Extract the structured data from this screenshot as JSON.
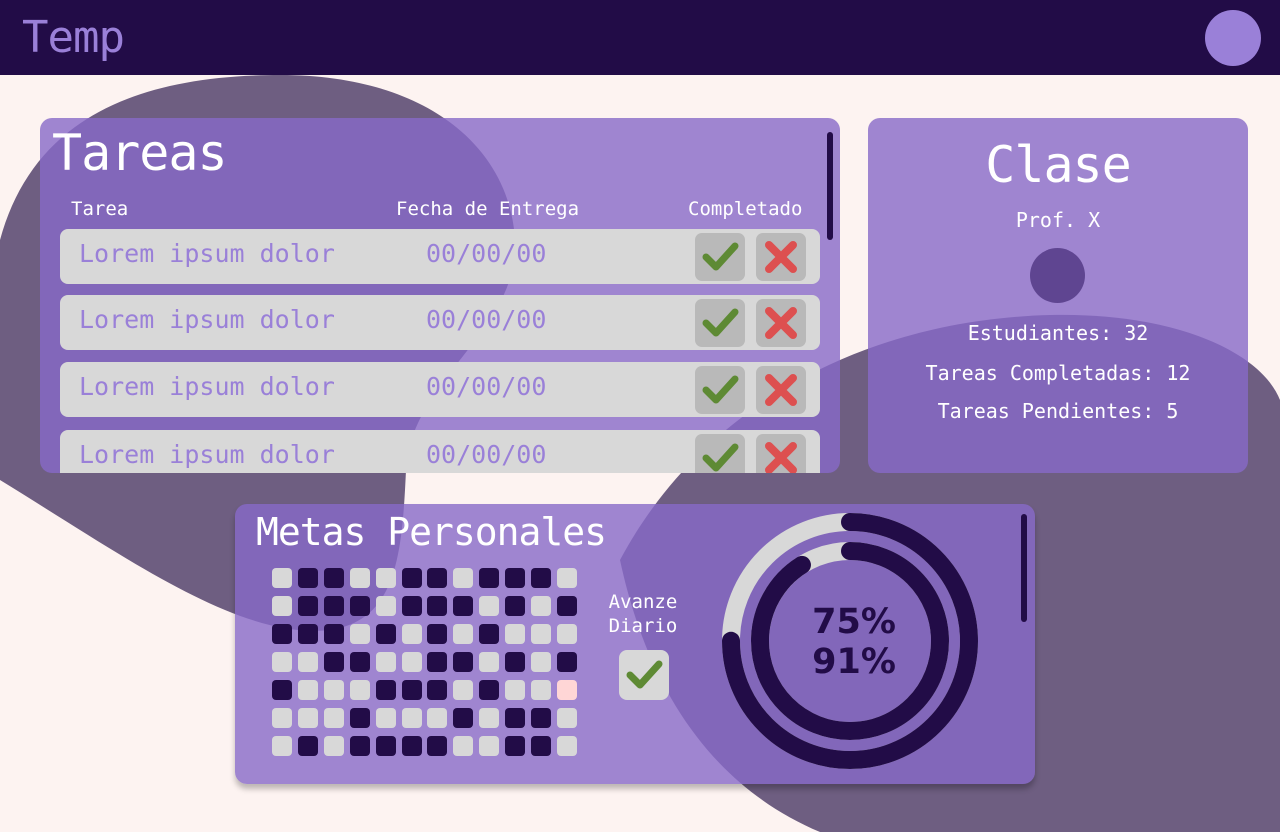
{
  "app": {
    "title": "Temp"
  },
  "colors": {
    "background": "#fdf3f1",
    "header": "#220c47",
    "accent": "#9a80d8",
    "panel": "#8769c8",
    "blob": "#6e5e81",
    "row": "#d8d8d8",
    "check": "#5e8a34",
    "cross": "#dd5050",
    "cell_on": "#220c47",
    "cell_off": "#d8d8d8",
    "cell_today": "#ffd6d6"
  },
  "tasks": {
    "title": "Tareas",
    "headers": {
      "task": "Tarea",
      "due": "Fecha de Entrega",
      "done": "Completado"
    },
    "rows": [
      {
        "name": "Lorem ipsum dolor",
        "due": "00/00/00"
      },
      {
        "name": "Lorem ipsum dolor",
        "due": "00/00/00"
      },
      {
        "name": "Lorem ipsum dolor",
        "due": "00/00/00"
      },
      {
        "name": "Lorem ipsum dolor",
        "due": "00/00/00"
      }
    ]
  },
  "class_info": {
    "title": "Clase",
    "professor": "Prof. X",
    "students": "Estudiantes: 32",
    "completed": "Tareas Completadas: 12",
    "pending": "Tareas Pendientes: 5"
  },
  "goals": {
    "title": "Metas Personales",
    "progress_label": [
      "Avanze",
      "Diario"
    ],
    "grid": [
      [
        0,
        1,
        1,
        0,
        0,
        1,
        1,
        0,
        1,
        1,
        1,
        0
      ],
      [
        0,
        1,
        1,
        1,
        0,
        1,
        1,
        1,
        0,
        1,
        0,
        1
      ],
      [
        1,
        1,
        1,
        0,
        1,
        0,
        1,
        0,
        1,
        0,
        0,
        0
      ],
      [
        0,
        0,
        1,
        1,
        0,
        0,
        1,
        1,
        0,
        1,
        0,
        1
      ],
      [
        1,
        0,
        0,
        0,
        1,
        1,
        1,
        0,
        1,
        0,
        0,
        2
      ],
      [
        0,
        0,
        0,
        1,
        0,
        0,
        0,
        1,
        0,
        1,
        1,
        0
      ],
      [
        0,
        1,
        0,
        1,
        1,
        1,
        1,
        0,
        0,
        1,
        1,
        0
      ]
    ],
    "outer_percent": "75%",
    "inner_percent": "91%",
    "outer_value": 0.75,
    "inner_value": 0.91
  }
}
